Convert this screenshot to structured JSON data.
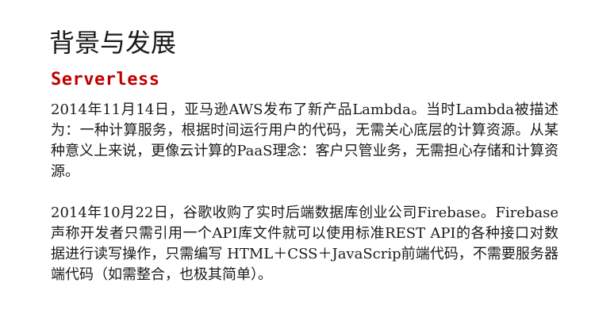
{
  "slide": {
    "title": "背景与发展",
    "subtitle": "Serverless",
    "subtitle_color": "#c00000",
    "paragraphs": [
      "2014年11月14日，亚马逊AWS发布了新产品Lambda。当时Lambda被描述为：一种计算服务，根据时间运行用户的代码，无需关心底层的计算资源。从某种意义上来说，更像云计算的PaaS理念：客户只管业务，无需担心存储和计算资源。",
      "2014年10月22日，谷歌收购了实时后端数据库创业公司Firebase。Firebase声称开发者只需引用一个API库文件就可以使用标准REST API的各种接口对数据进行读写操作，只需编写 HTML＋CSS＋JavaScrip前端代码，不需要服务器端代码（如需整合，也极其简单）。"
    ]
  }
}
